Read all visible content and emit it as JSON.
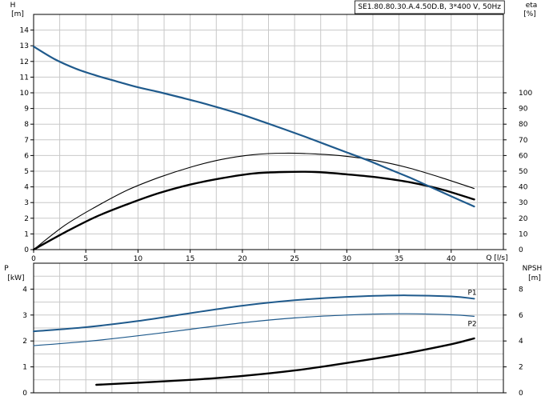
{
  "chart_data": [
    {
      "type": "line",
      "title": "SE1.80.80.30.A.4.50D.B, 3*400 V, 50Hz",
      "xlabel": "Q [l/s]",
      "xlim": [
        0,
        45
      ],
      "xticks": [
        0,
        5,
        10,
        15,
        20,
        25,
        30,
        35,
        40
      ],
      "ylabel_left": [
        "H",
        "[m]"
      ],
      "ylim_left": [
        0,
        15
      ],
      "yticks_left": [
        0,
        1,
        2,
        3,
        4,
        5,
        6,
        7,
        8,
        9,
        10,
        11,
        12,
        13,
        14
      ],
      "ylabel_right": [
        "eta",
        "[%]"
      ],
      "ylim_right": [
        0,
        150
      ],
      "yticks_right": [
        0,
        10,
        20,
        30,
        40,
        50,
        60,
        70,
        80,
        90,
        100
      ],
      "grid": true,
      "colors": {
        "head": "#1f5a8c",
        "eta": "#000000",
        "eta_bold": "#000000"
      },
      "series": [
        {
          "id": "head",
          "axis": "left",
          "x": [
            0,
            2,
            4,
            6,
            8,
            10,
            12,
            14,
            16,
            18,
            20,
            22,
            24,
            26,
            28,
            30,
            32,
            34,
            36,
            38,
            40,
            42.2
          ],
          "y": [
            12.95,
            12.15,
            11.55,
            11.1,
            10.72,
            10.35,
            10.05,
            9.72,
            9.38,
            9.0,
            8.6,
            8.15,
            7.68,
            7.2,
            6.7,
            6.2,
            5.7,
            5.15,
            4.6,
            4.0,
            3.4,
            2.75
          ]
        },
        {
          "id": "eta_thin",
          "axis": "right",
          "x": [
            0,
            3,
            6,
            9,
            12,
            15,
            18,
            21,
            24,
            27,
            30,
            33,
            36,
            39,
            42.2
          ],
          "y": [
            0,
            15.5,
            27.5,
            38,
            46,
            52.5,
            57.5,
            60.5,
            61.5,
            61,
            59.5,
            56.5,
            52,
            46,
            39
          ]
        },
        {
          "id": "eta_bold",
          "axis": "right",
          "x": [
            0,
            3,
            6,
            9,
            12,
            15,
            18,
            21,
            24,
            27,
            30,
            33,
            36,
            39,
            42.2
          ],
          "y": [
            0,
            11,
            21,
            29,
            36,
            41.5,
            45.5,
            48.5,
            49.5,
            49.5,
            48,
            46,
            43,
            38.5,
            32
          ]
        }
      ]
    },
    {
      "type": "line",
      "xlim": [
        0,
        45
      ],
      "ylabel_left": [
        "P",
        "[kW]"
      ],
      "ylim_left": [
        0,
        5
      ],
      "yticks_left": [
        0,
        1,
        2,
        3,
        4
      ],
      "ylabel_right": [
        "NPSH",
        "[m]"
      ],
      "ylim_right": [
        0,
        10
      ],
      "yticks_right": [
        0,
        2,
        4,
        6,
        8
      ],
      "grid": true,
      "colors": {
        "P1": "#1f5a8c",
        "P2": "#1f5a8c",
        "npsh": "#000000"
      },
      "series": [
        {
          "id": "P1",
          "name": "P1",
          "axis": "left",
          "x": [
            0,
            5,
            10,
            15,
            20,
            25,
            30,
            35,
            40,
            42.2
          ],
          "y": [
            2.37,
            2.53,
            2.77,
            3.07,
            3.36,
            3.57,
            3.7,
            3.76,
            3.72,
            3.63
          ]
        },
        {
          "id": "P2",
          "name": "P2",
          "axis": "left",
          "x": [
            0,
            5,
            10,
            15,
            20,
            25,
            30,
            35,
            40,
            42.2
          ],
          "y": [
            1.82,
            1.98,
            2.2,
            2.45,
            2.7,
            2.89,
            3.0,
            3.05,
            3.01,
            2.95
          ]
        },
        {
          "id": "npsh",
          "axis": "right",
          "x": [
            6,
            10,
            15,
            20,
            25,
            30,
            35,
            40,
            42.2
          ],
          "y": [
            0.62,
            0.78,
            1.0,
            1.3,
            1.72,
            2.3,
            2.95,
            3.75,
            4.2
          ]
        }
      ]
    }
  ]
}
